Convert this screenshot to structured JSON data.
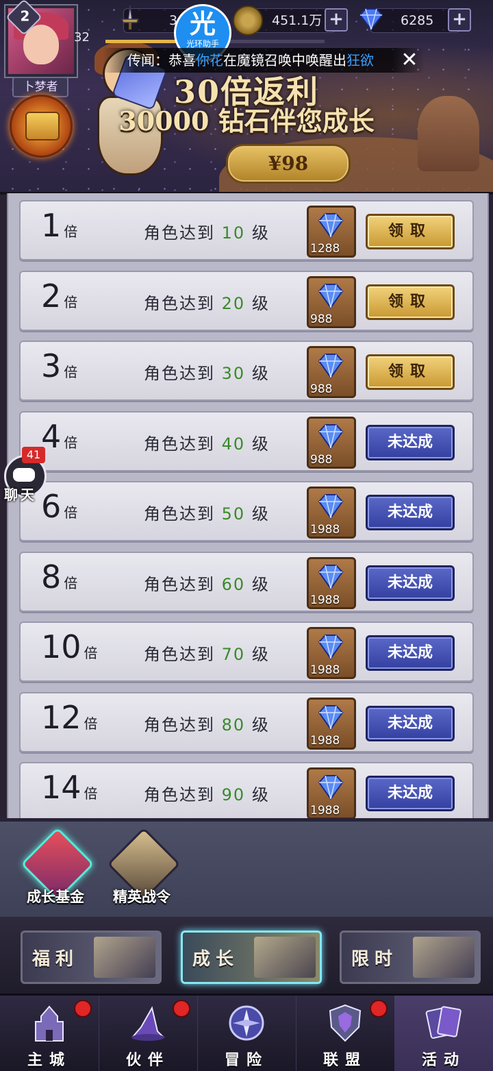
{
  "hud": {
    "level": "2",
    "xp_level": "32",
    "xp_progress": 0.34,
    "power_partial": "3",
    "gold": "451.1万",
    "diamonds": "6285",
    "player_tag": "卜梦者",
    "helper_big": "光",
    "helper_small": "光环助手"
  },
  "marquee": {
    "prefix": "传闻：恭喜",
    "name": "你花",
    "middle": "在魔镜召唤中唤醒出",
    "item": "狂欲"
  },
  "banner": {
    "title_line1": "30倍返利",
    "title_line2": "30000 钻石伴您成长",
    "price": "¥98"
  },
  "rewards": [
    {
      "multiplier": "1",
      "unit": "倍",
      "cond_prefix": "角色达到",
      "level": "10",
      "cond_suffix": "级",
      "gems": "1288",
      "button": "领取",
      "state": "claim"
    },
    {
      "multiplier": "2",
      "unit": "倍",
      "cond_prefix": "角色达到",
      "level": "20",
      "cond_suffix": "级",
      "gems": "988",
      "button": "领取",
      "state": "claim"
    },
    {
      "multiplier": "3",
      "unit": "倍",
      "cond_prefix": "角色达到",
      "level": "30",
      "cond_suffix": "级",
      "gems": "988",
      "button": "领取",
      "state": "claim"
    },
    {
      "multiplier": "4",
      "unit": "倍",
      "cond_prefix": "角色达到",
      "level": "40",
      "cond_suffix": "级",
      "gems": "988",
      "button": "未达成",
      "state": "locked"
    },
    {
      "multiplier": "6",
      "unit": "倍",
      "cond_prefix": "角色达到",
      "level": "50",
      "cond_suffix": "级",
      "gems": "1988",
      "button": "未达成",
      "state": "locked"
    },
    {
      "multiplier": "8",
      "unit": "倍",
      "cond_prefix": "角色达到",
      "level": "60",
      "cond_suffix": "级",
      "gems": "1988",
      "button": "未达成",
      "state": "locked"
    },
    {
      "multiplier": "10",
      "unit": "倍",
      "cond_prefix": "角色达到",
      "level": "70",
      "cond_suffix": "级",
      "gems": "1988",
      "button": "未达成",
      "state": "locked"
    },
    {
      "multiplier": "12",
      "unit": "倍",
      "cond_prefix": "角色达到",
      "level": "80",
      "cond_suffix": "级",
      "gems": "1988",
      "button": "未达成",
      "state": "locked"
    },
    {
      "multiplier": "14",
      "unit": "倍",
      "cond_prefix": "角色达到",
      "level": "90",
      "cond_suffix": "级",
      "gems": "1988",
      "button": "未达成",
      "state": "locked"
    }
  ],
  "chat": {
    "badge": "41",
    "label": "聊天"
  },
  "subtabs": [
    {
      "label": "成长基金"
    },
    {
      "label": "精英战令"
    }
  ],
  "categories": [
    {
      "label": "福利"
    },
    {
      "label": "成长"
    },
    {
      "label": "限时"
    }
  ],
  "nav": [
    {
      "label": "主城"
    },
    {
      "label": "伙伴"
    },
    {
      "label": "冒险"
    },
    {
      "label": "联盟"
    },
    {
      "label": "活动"
    }
  ],
  "colors": {
    "claim_button": "#d8b04e",
    "locked_button": "#4452b4",
    "level_green": "#3a8a2a",
    "notification_red": "#e02626"
  }
}
